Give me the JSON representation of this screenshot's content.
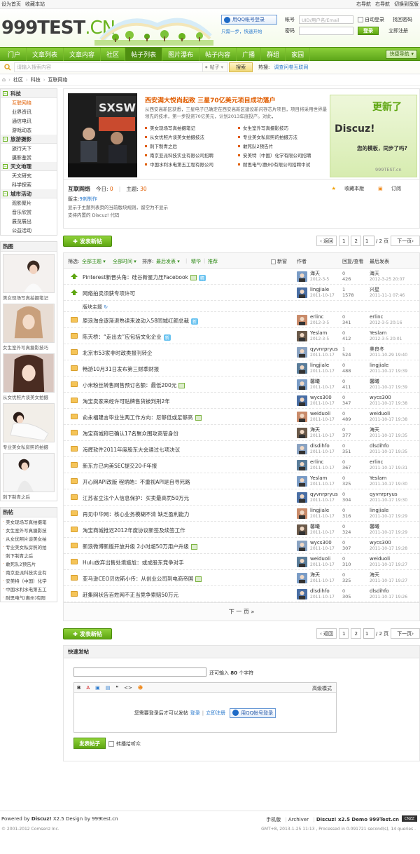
{
  "topbar": {
    "left": [
      "设为首页",
      "收藏本站"
    ],
    "right": [
      "右导航",
      "右导航",
      "切换到宽版"
    ]
  },
  "header": {
    "logo_main": "999TEST",
    "logo_suffix": ".CN",
    "qq_button": "用QQ帐号登录",
    "qq_tip": "只需一步，快速开始",
    "login": {
      "user_label": "帐号",
      "user_placeholder": "UID/用户名/Email",
      "pass_label": "密码",
      "auto_login": "自动登录",
      "find_password": "找回密码",
      "login_button": "登录",
      "register": "立即注册"
    }
  },
  "nav": {
    "items": [
      "门户",
      "文章列表",
      "文章内容",
      "社区",
      "帖子列表",
      "图片瀑布",
      "帖子内容",
      "广播",
      "群组",
      "家园"
    ],
    "active_index": 4,
    "quick": "快捷导航"
  },
  "search": {
    "placeholder": "请输入搜索内容",
    "type": "帖子",
    "button": "搜索",
    "hot_label": "热搜:",
    "hot": [
      "调查问卷",
      "互联网"
    ]
  },
  "breadcrumb": [
    "社区",
    "科技",
    "互联网络"
  ],
  "sidebar": {
    "sections": [
      {
        "title": "科技",
        "items": [
          "互联网络",
          "业界资讯",
          "通信电讯",
          "游戏动态"
        ]
      },
      {
        "title": "旅游摄影",
        "items": [
          "旅行天下",
          "摄影鉴赏"
        ]
      },
      {
        "title": "天文地理",
        "items": [
          "天文研究",
          "科学探索"
        ]
      },
      {
        "title": "城市活动",
        "items": [
          "观影聚片",
          "音乐欣赏",
          "展览展出",
          "公益活动"
        ]
      }
    ],
    "current": "互联网络",
    "pics_title": "热图",
    "pics": [
      "美女现场写真拍摄笔记",
      "女生室外写真摄影技巧",
      "从女优照片谈美女拍摄",
      "专业美女私房照的拍摄",
      "刺下制青之后"
    ],
    "hot_title": "热帖",
    "hot": [
      "美女现场写真拍摄笔",
      "女生室外写真摄影技",
      "从女优照片谈美女拍",
      "专业美女私房照的拍",
      "刺下制青之后",
      "敢死队2预告片",
      "南京亚派科技实业有",
      "安美特（中国）化学",
      "中国水利水电第五工",
      "耐思电气(惠州)有限"
    ]
  },
  "promo": {
    "title": "西安满大悦尚起致 三星70亿美元项目成功落户",
    "desc": "从西安高新区获悉，三星电子已确定在西安高新区建设新闪存芯片项目，项目将采用世界最领先的技术，第一步投资70亿美元，计划2013年底投产。对此，",
    "links": [
      "美女现场写真拍摄笔记",
      "女生室外写真摄影技巧",
      "从女优照片谈美女拍摄技法",
      "专业美女私房照的拍摄方法",
      "刺下制青之后",
      "敢死队2预告片",
      "南京亚派科技实业有限公司招聘",
      "安美特（中国）化学有限公司招聘",
      "中国水利水电第五工程有限公司",
      "耐思电气(惠州)有限公司招聘中试"
    ],
    "ad_line1": "更新了",
    "ad_line2": "Discuz!",
    "ad_line3": "您的模板，同步了吗?",
    "ad_line4": "999TEST.cn",
    "photo_sign": "SXSW"
  },
  "forum": {
    "name": "互联网络",
    "today_label": "今日:",
    "today": "0",
    "topics_label": "主题:",
    "topics": "30",
    "favorite": "收藏本版",
    "subscribe": "订阅",
    "mod_label": "版主:",
    "mod": "9刺制作",
    "rule1": "显示于主题列表页的当前版块规则，留空为不显示",
    "rule2": "支持内置的 Discuz! 代码"
  },
  "postbar": {
    "new_post": "发表新帖",
    "prev": "返回",
    "pages": [
      "1",
      "2"
    ],
    "current": "1",
    "total": "/ 2 页",
    "next": "下一页"
  },
  "filter": {
    "label": "筛选:",
    "all_topics": "全部主题",
    "all_time": "全部时间",
    "sort_label": "排序:",
    "sort": "最后发表",
    "digest": "精华",
    "recommend": "推荐",
    "new_window": "新窗",
    "col_author": "作者",
    "col_reply": "回复/查看",
    "col_last": "最后发表"
  },
  "threads": [
    {
      "title": "Pinterest新晋头角：硅谷新星力压Facebook",
      "icon": "up",
      "img": true,
      "badge": "精",
      "author": "海天",
      "date": "2012-3-5",
      "replies": "0",
      "views": "426",
      "last": "海天",
      "last_date": "2012-3-25 20:07"
    },
    {
      "title": "网络拍卖须获专项许可",
      "icon": "up",
      "img": false,
      "badge": "",
      "author": "lingjiale",
      "date": "2011-10-17",
      "replies": "1",
      "views": "1578",
      "last": "兴星",
      "last_date": "2011-11-1 07:46"
    },
    {
      "title": "原浪淘金逐渐退熟读来波动入58同城红颜总裁",
      "icon": "folder",
      "img": false,
      "badge": "新",
      "author": "erlinc",
      "date": "2012-3-5",
      "replies": "0",
      "views": "341",
      "last": "erlinc",
      "last_date": "2012-3-5 20:16"
    },
    {
      "title": "陈天桥：“走出去”应包括文化企业",
      "icon": "folder",
      "img": false,
      "badge": "新",
      "author": "Yeslam",
      "date": "2012-3-5",
      "replies": "0",
      "views": "412",
      "last": "Yeslam",
      "last_date": "2012-3-5 20:01"
    },
    {
      "title": "北京市53家非时政类报刊转企",
      "icon": "folder",
      "img": false,
      "badge": "",
      "author": "qyvnrpryus",
      "date": "2011-10-17",
      "replies": "1",
      "views": "524",
      "last": "美良冬",
      "last_date": "2011-10-29 19:40"
    },
    {
      "title": "畅游10月31日发布第三财季财报",
      "icon": "folder",
      "img": false,
      "badge": "",
      "author": "lingjiale",
      "date": "2011-10-17",
      "replies": "0",
      "views": "488",
      "last": "lingjiale",
      "last_date": "2011-10-17 19:39"
    },
    {
      "title": "小米粉丝转售网售预订名额：最低200元",
      "icon": "folder",
      "img": true,
      "badge": "",
      "author": "馨曦",
      "date": "2011-10-17",
      "replies": "0",
      "views": "411",
      "last": "馨曦",
      "last_date": "2011-10-17 19:39"
    },
    {
      "title": "淘宝卖家来经许可贴牌售货被判刑2年",
      "icon": "folder",
      "img": false,
      "badge": "",
      "author": "wycs300",
      "date": "2011-10-17",
      "replies": "0",
      "views": "347",
      "last": "wycs300",
      "last_date": "2011-10-17 19:38"
    },
    {
      "title": "俞永福建言毕业生两工作方向：尼够低或足够高",
      "icon": "folder",
      "img": true,
      "badge": "",
      "author": "weiduoli",
      "date": "2011-10-17",
      "replies": "0",
      "views": "489",
      "last": "weiduoli",
      "last_date": "2011-10-17 19:38"
    },
    {
      "title": "淘宝商城称已确认17名聚众围攻商管身份",
      "icon": "folder",
      "img": false,
      "badge": "",
      "author": "海天",
      "date": "2011-10-17",
      "replies": "0",
      "views": "377",
      "last": "海天",
      "last_date": "2011-10-17 19:35"
    },
    {
      "title": "海辉软件2011年度股东大会通过七项决议",
      "icon": "folder",
      "img": false,
      "badge": "",
      "author": "dlsdihfo",
      "date": "2011-10-17",
      "replies": "0",
      "views": "351",
      "last": "dlsdihfo",
      "last_date": "2011-10-17 19:35"
    },
    {
      "title": "新东方已向美SEC提交20-F年报",
      "icon": "folder",
      "img": false,
      "badge": "",
      "author": "erlinc",
      "date": "2011-10-17",
      "replies": "0",
      "views": "367",
      "last": "erlinc",
      "last_date": "2011-10-17 19:31"
    },
    {
      "title": "开心网API改版 程炳皓：不重视API是自寻死路",
      "icon": "folder",
      "img": false,
      "badge": "",
      "author": "Yeslam",
      "date": "2011-10-17",
      "replies": "0",
      "views": "325",
      "last": "Yeslam",
      "last_date": "2011-10-17 19:30"
    },
    {
      "title": "江苏省立法个人信息保护：买卖最高罚50万元",
      "icon": "folder",
      "img": false,
      "badge": "",
      "author": "qyvnrpryus",
      "date": "2011-10-17",
      "replies": "0",
      "views": "304",
      "last": "qyvnrpryus",
      "last_date": "2011-10-17 19:30"
    },
    {
      "title": "再见中华网：核心业务模糊不清 缺乏盈利能力",
      "icon": "folder",
      "img": false,
      "badge": "",
      "author": "lingjiale",
      "date": "2011-10-17",
      "replies": "0",
      "views": "316",
      "last": "lingjiale",
      "last_date": "2011-10-17 19:29"
    },
    {
      "title": "淘宝商城推迟2012年度协议新签及续签工作",
      "icon": "folder",
      "img": false,
      "badge": "",
      "author": "馨曦",
      "date": "2011-10-17",
      "replies": "0",
      "views": "324",
      "last": "馨曦",
      "last_date": "2011-10-17 19:29"
    },
    {
      "title": "新浪微博新版开放升级 2小时超50万用户升级",
      "icon": "folder",
      "img": true,
      "badge": "",
      "author": "wycs300",
      "date": "2011-10-17",
      "replies": "0",
      "views": "307",
      "last": "wycs300",
      "last_date": "2011-10-17 19:28"
    },
    {
      "title": "Hulu放弃出售处境尴尬：或成股东竞争对手",
      "icon": "folder",
      "img": false,
      "badge": "",
      "author": "weiduoli",
      "date": "2011-10-17",
      "replies": "0",
      "views": "310",
      "last": "weiduoli",
      "last_date": "2011-10-17 19:27"
    },
    {
      "title": "亚马逊CEO贝佐斯小传：从创业公司到电商帝国",
      "icon": "folder",
      "img": true,
      "badge": "",
      "author": "海天",
      "date": "2011-10-17",
      "replies": "0",
      "views": "325",
      "last": "海天",
      "last_date": "2011-10-17 19:27"
    },
    {
      "title": "赶集网状告百姓网不正当竞争索赔50万元",
      "icon": "folder",
      "img": false,
      "badge": "",
      "author": "dlsdihfo",
      "date": "2011-10-17",
      "replies": "0",
      "views": "305",
      "last": "dlsdihfo",
      "last_date": "2011-10-17 19:26"
    }
  ],
  "section_notice": "版块主题",
  "next_page": "下 一 页  »",
  "quickpost": {
    "title": "快速发帖",
    "remain_prefix": "还可输入",
    "remain_num": "80",
    "remain_suffix": "个字符",
    "toolbar": [
      "B",
      "A",
      "▣",
      "▤",
      "❝",
      "<>",
      "☻"
    ],
    "advanced": "高级模式",
    "login_need": "您需要登录后才可以发帖",
    "login": "登录",
    "sep": "|",
    "register": "立即注册",
    "qq_button": "用QQ帐号登录",
    "submit": "发表帖子",
    "notify": "转播给听众"
  },
  "footer": {
    "powered": "Powered by",
    "discuz": "Discuz!",
    "ver": "X2.5 Design by 999test.cn",
    "copyright": "© 2001-2012 Comsenz Inc.",
    "links": [
      "手机版",
      "|",
      "Archiver",
      "|",
      "Discuz! x2.5 Demo 999Test.cn"
    ],
    "cnzz": "CNZZ",
    "time": "GMT+8, 2013-1-25 11:13 , Processed in 0.091721 second(s), 14 queries ."
  },
  "colors": {
    "accent": "#69b41f",
    "orange": "#e05d00",
    "link": "#2b7acd"
  }
}
